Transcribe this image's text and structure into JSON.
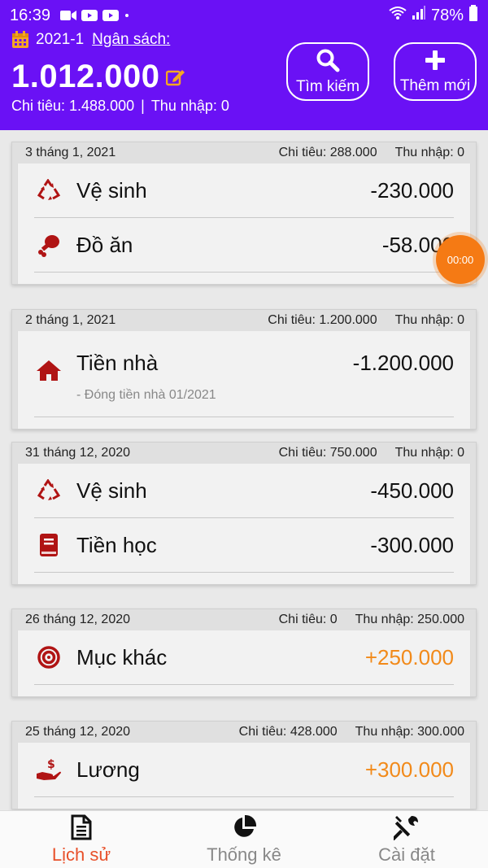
{
  "status_bar": {
    "time": "16:39",
    "battery": "78%"
  },
  "header": {
    "period": "2021-1",
    "budget_label": "Ngân sách:",
    "budget_amount": "1.012.000",
    "expense_summary": "Chi tiêu: 1.488.000",
    "separator": "|",
    "income_summary": "Thu nhập: 0",
    "search_label": "Tìm kiếm",
    "add_label": "Thêm mới",
    "bg_color": "#6a11f5"
  },
  "days": [
    {
      "date": "3 tháng 1, 2021",
      "expense": "Chi tiêu: 288.000",
      "income": "Thu nhập: 0",
      "items": [
        {
          "icon": "recycle-icon",
          "name": "Vệ sinh",
          "amount": "-230.000"
        },
        {
          "icon": "chicken-leg-icon",
          "name": "Đồ ăn",
          "amount": "-58.000"
        }
      ]
    },
    {
      "date": "2 tháng 1, 2021",
      "expense": "Chi tiêu: 1.200.000",
      "income": "Thu nhập: 0",
      "items": [
        {
          "icon": "home-icon",
          "name": "Tiền nhà",
          "amount": "-1.200.000",
          "note": "- Đóng tiền nhà 01/2021"
        }
      ]
    },
    {
      "date": "31 tháng 12, 2020",
      "expense": "Chi tiêu: 750.000",
      "income": "Thu nhập: 0",
      "items": [
        {
          "icon": "recycle-icon",
          "name": "Vệ sinh",
          "amount": "-450.000"
        },
        {
          "icon": "book-icon",
          "name": "Tiền học",
          "amount": "-300.000"
        }
      ]
    },
    {
      "date": "26 tháng 12, 2020",
      "expense": "Chi tiêu: 0",
      "income": "Thu nhập: 250.000",
      "items": [
        {
          "icon": "target-icon",
          "name": "Mục khác",
          "amount": "+250.000"
        }
      ]
    },
    {
      "date": "25 tháng 12, 2020",
      "expense": "Chi tiêu: 428.000",
      "income": "Thu nhập: 300.000",
      "items": [
        {
          "icon": "salary-hand-icon",
          "name": "Lương",
          "amount": "+300.000"
        }
      ]
    }
  ],
  "timer": {
    "label": "00:00"
  },
  "nav": {
    "history": "Lịch sử",
    "stats": "Thống kê",
    "settings": "Cài đặt"
  },
  "colors": {
    "income": "#f28a1a",
    "icon": "#b01414",
    "active_nav": "#e8502a"
  }
}
